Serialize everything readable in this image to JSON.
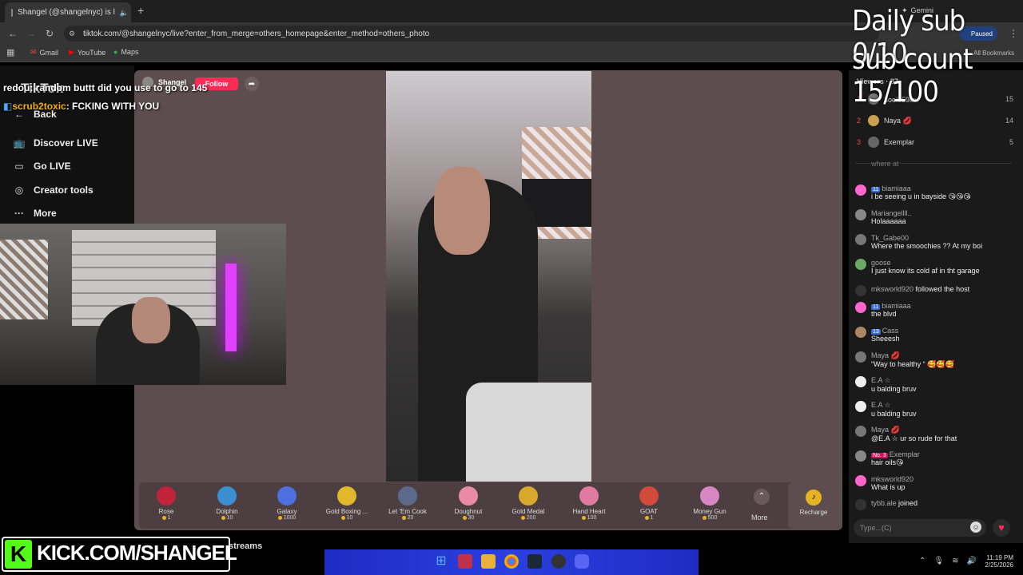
{
  "browser": {
    "tab_title": "Shangel (@shangelnyc) is l",
    "url": "tiktok.com/@shangelnyc/live?enter_from_merge=others_homepage&enter_method=others_photo",
    "bookmarks": [
      "Gmail",
      "YouTube",
      "Maps"
    ],
    "gemini_label": "Gemini",
    "paused_label": "Paused",
    "all_bookmarks": "All Bookmarks"
  },
  "overlay": {
    "daily_sub": "Daily sub 0/10",
    "sub_count": "sub count 15/100",
    "chat_line1": "redou: random buttt did you use to go to 145",
    "chat_line2_user": "scrub2toxic",
    "chat_line2_text": ": FCKING WITH YOU",
    "kick_url": "KICK.COM/SHANGEL",
    "streams": "streams"
  },
  "tiktok": {
    "logo": "TikTok",
    "back": "Back",
    "nav": [
      "Discover LIVE",
      "Go LIVE",
      "Creator tools",
      "More"
    ],
    "host_name": "Shangel",
    "follow": "Follow"
  },
  "gifts": [
    {
      "name": "Rose",
      "price": "1",
      "color": "#c0233a"
    },
    {
      "name": "Dolphin",
      "price": "10",
      "color": "#3b8fd1"
    },
    {
      "name": "Galaxy",
      "price": "1000",
      "color": "#4e6fe0"
    },
    {
      "name": "Gold Boxing ...",
      "price": "10",
      "color": "#e0b82a"
    },
    {
      "name": "Let 'Em Cook",
      "price": "20",
      "color": "#5a6a8a"
    },
    {
      "name": "Doughnut",
      "price": "30",
      "color": "#e98aa6"
    },
    {
      "name": "Gold Medal",
      "price": "200",
      "color": "#d9a92c"
    },
    {
      "name": "Hand Heart",
      "price": "100",
      "color": "#e07aa0"
    },
    {
      "name": "GOAT",
      "price": "1",
      "color": "#d24a3a"
    },
    {
      "name": "Money Gun",
      "price": "500",
      "color": "#d887c4"
    }
  ],
  "gift_more": "More",
  "recharge": "Recharge",
  "viewers": {
    "header": "Viewers · 87",
    "list": [
      {
        "rank": "1",
        "name": "Ꝫoel559ᴍx",
        "count": "15"
      },
      {
        "rank": "2",
        "name": "Naya 💋",
        "count": "14"
      },
      {
        "rank": "3",
        "name": "Exemplar",
        "count": "5"
      }
    ]
  },
  "chat": [
    {
      "user": "",
      "text": "where at"
    },
    {
      "user": "biamiaaa",
      "badge": "11",
      "text": "i be seeing u in bayside 😘😘😘"
    },
    {
      "user": "Mariangellll..",
      "text": "Holaaaaaa"
    },
    {
      "user": "Tk_Gabe00",
      "text": "Where the smoochies ?? At my boi"
    },
    {
      "user": "goose",
      "text": "I just know its cold af in tht garage"
    },
    {
      "user": "mksworld920",
      "text": "followed the host",
      "inline": true
    },
    {
      "user": "biamiaaa",
      "badge": "11",
      "text": "the blvd"
    },
    {
      "user": "Cass",
      "badge": "13",
      "text": "Sheeesh"
    },
    {
      "user": "Maya 💋",
      "text": "“Way to healthy “ 🥰🥰🥰"
    },
    {
      "user": "E.A ☆",
      "text": "u balding bruv"
    },
    {
      "user": "E.A ☆",
      "text": "u balding bruv"
    },
    {
      "user": "Maya 💋",
      "text": "@E.A ☆ ur so rude for that"
    },
    {
      "user": "Exemplar",
      "badge2": "No. 3",
      "text": "hair oils😘"
    },
    {
      "user": "mksworld920",
      "text": "What is up"
    },
    {
      "user": "tybb.ale",
      "text": "joined",
      "inline": true
    }
  ],
  "chat_placeholder": "Type...(C)",
  "clock": {
    "time": "11:19 PM",
    "date": "2/25/2026"
  }
}
